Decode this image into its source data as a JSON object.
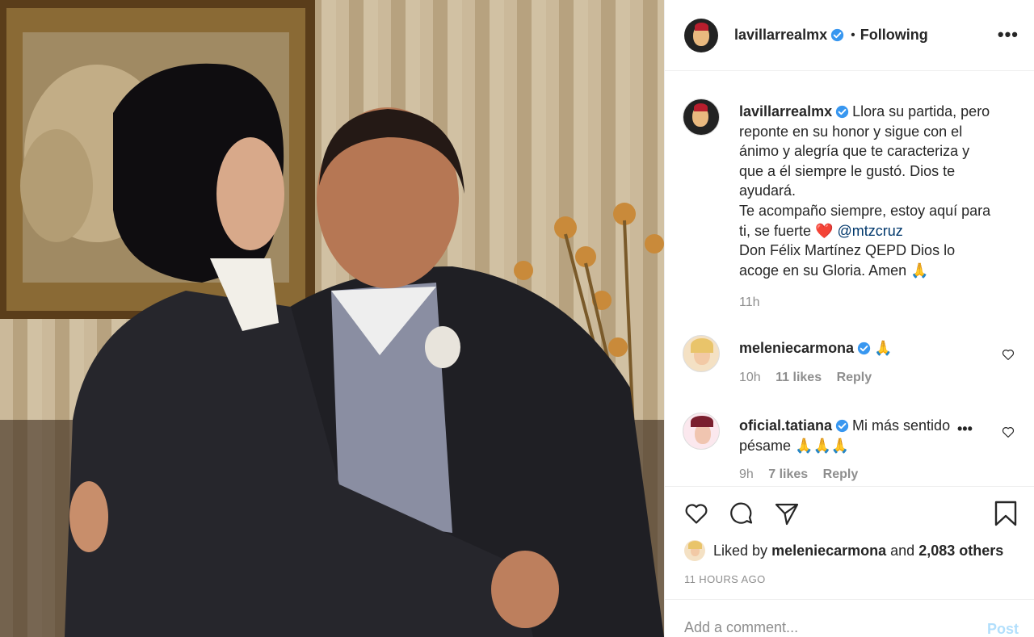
{
  "post": {
    "author": "lavillarrealmx",
    "follow_status": "Following",
    "more_label": "•••",
    "caption_lines": [
      "Llora su partida, pero",
      "reponte en su honor y sigue con el",
      "ánimo y alegría que te caracteriza y",
      "que a él siempre le gustó. Dios te",
      "ayudará."
    ],
    "caption_line2_pre": "Te acompaño siempre, estoy aquí para",
    "caption_line3_pre": "ti, se fuerte",
    "caption_heart": "❤️",
    "caption_mention": "@mtzcruz",
    "caption_line4": "Don Félix Martínez QEPD Dios lo",
    "caption_line5_pre": "acoge en su Gloria. Amen",
    "caption_pray": "🙏",
    "caption_time": "11h"
  },
  "comments": [
    {
      "user": "meleniecarmona",
      "text": "🙏",
      "time": "10h",
      "likes": "11 likes",
      "reply": "Reply"
    },
    {
      "user": "oficial.tatiana",
      "text_line1": "Mi más sentido",
      "text_line2": "pésame 🙏🙏🙏",
      "ellipsis": "•••",
      "time": "9h",
      "likes": "7 likes",
      "reply": "Reply"
    }
  ],
  "engagement": {
    "liked_by_prefix": "Liked by",
    "liked_by_user": "meleniecarmona",
    "and_text": "and",
    "others": "2,083 others",
    "timestamp": "11 HOURS AGO"
  },
  "composer": {
    "placeholder": "Add a comment...",
    "post_label": "Post"
  },
  "colors": {
    "verified": "#3897f0",
    "mention": "#00376b",
    "post_disabled": "#b2dffc"
  }
}
